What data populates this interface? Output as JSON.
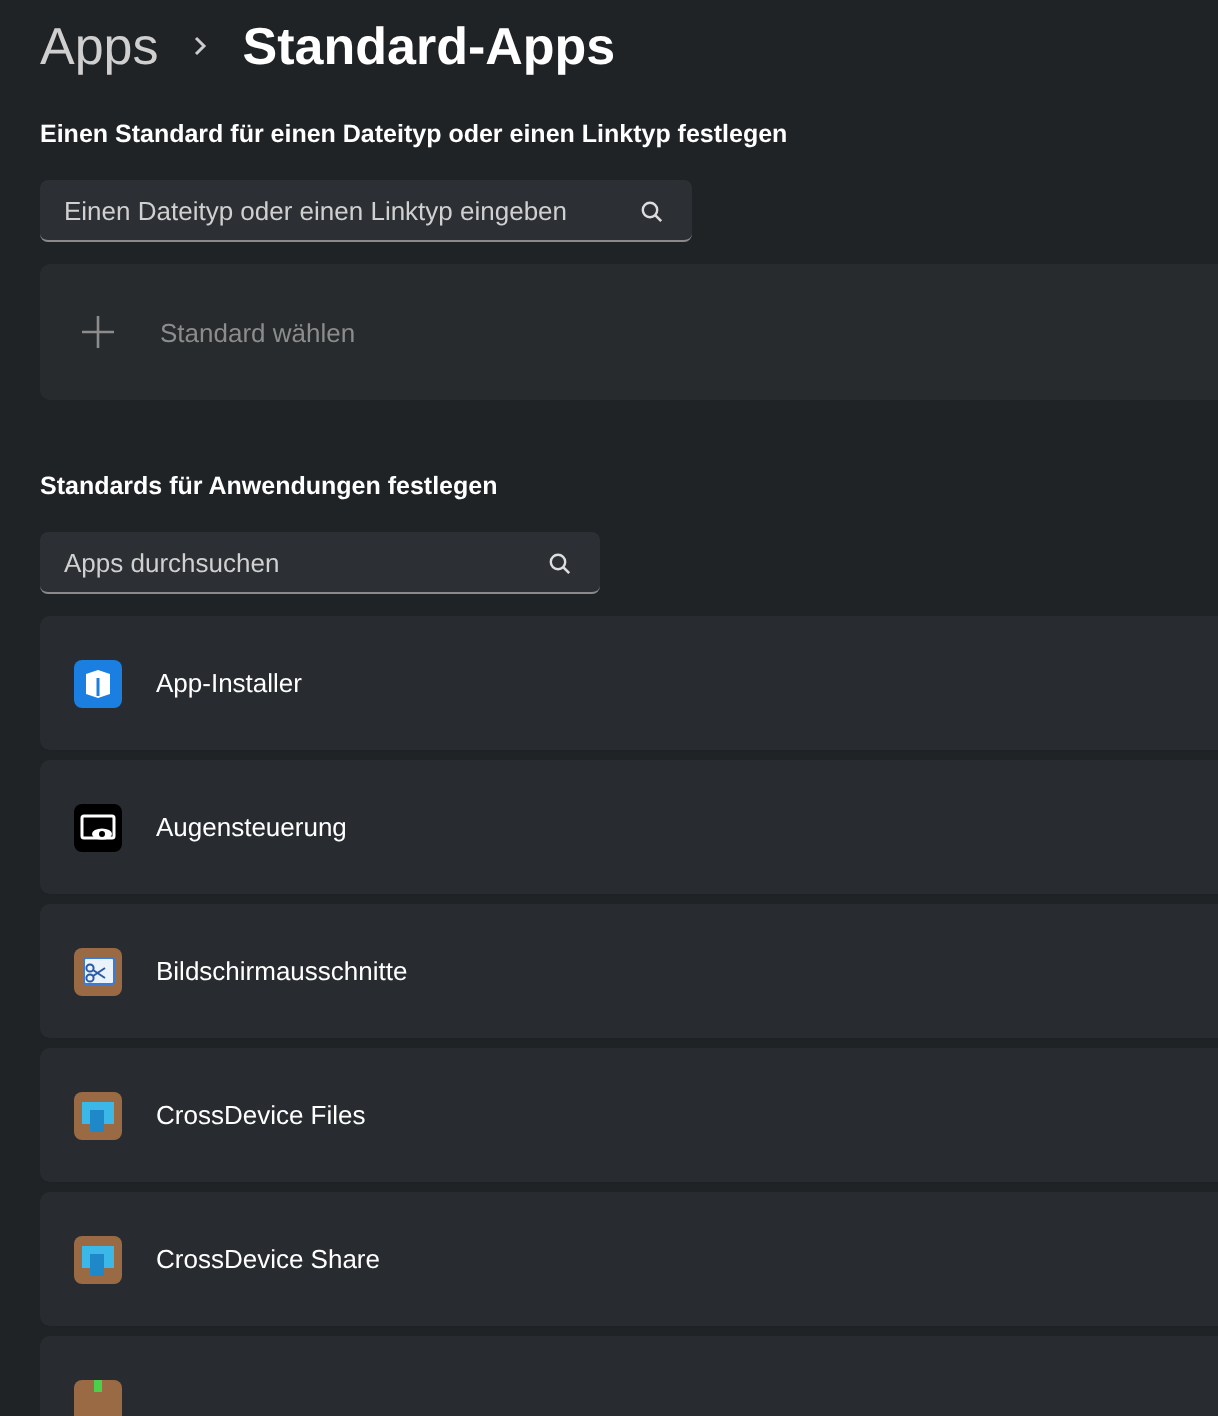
{
  "breadcrumb": {
    "parent": "Apps",
    "current": "Standard-Apps"
  },
  "filetype_section": {
    "heading": "Einen Standard für einen Dateityp oder einen Linktyp festlegen",
    "search": {
      "placeholder": "Einen Dateityp oder einen Linktyp eingeben"
    },
    "add_card": {
      "label": "Standard wählen"
    }
  },
  "apps_section": {
    "heading": "Standards für Anwendungen festlegen",
    "search": {
      "placeholder": "Apps durchsuchen"
    },
    "apps": [
      {
        "name": "App-Installer",
        "kind": "installer"
      },
      {
        "name": "Augensteuerung",
        "kind": "eye"
      },
      {
        "name": "Bildschirmausschnitte",
        "kind": "snip"
      },
      {
        "name": "CrossDevice Files",
        "kind": "monitor"
      },
      {
        "name": "CrossDevice Share",
        "kind": "monitor"
      },
      {
        "kind": "generic"
      }
    ]
  }
}
